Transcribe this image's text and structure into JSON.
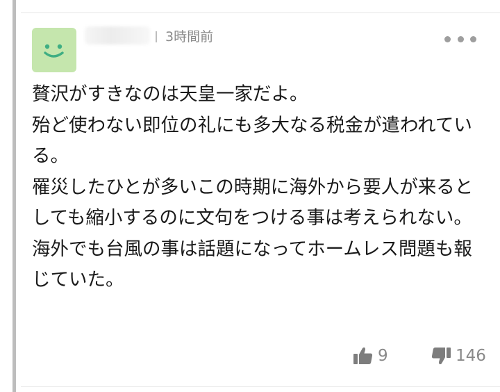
{
  "comment": {
    "avatar_icon": "smiley-face-icon",
    "avatar_color": "#c5e6ad",
    "timestamp": "3時間前",
    "more_icon": "more-options-icon",
    "body": [
      "贅沢がすきなのは天皇一家だよ。",
      "殆ど使わない即位の礼にも多大なる税金が遣われている。",
      "罹災したひとが多いこの時期に海外から要人が来るとしても縮小するのに文句をつける事は考えられない。",
      "海外でも台風の事は話題になってホームレス問題も報じていた。"
    ],
    "likes": "9",
    "dislikes": "146",
    "like_icon": "thumbs-up-icon",
    "dislike_icon": "thumbs-down-icon"
  }
}
